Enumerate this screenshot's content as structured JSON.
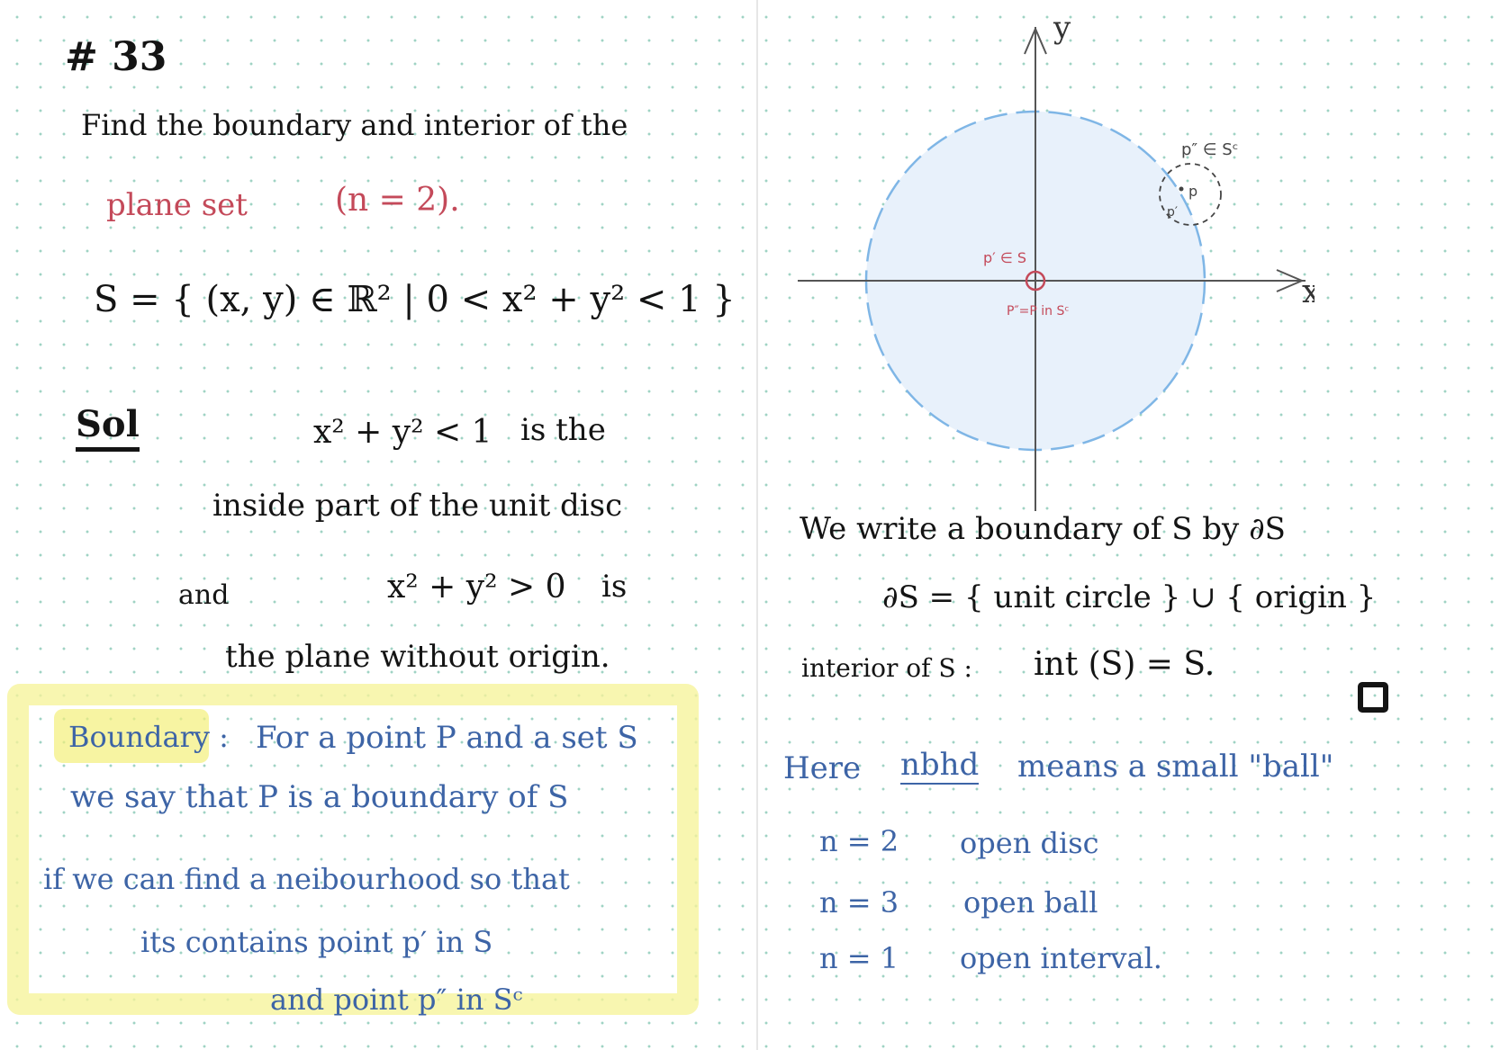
{
  "left": {
    "heading": "# 33",
    "problem_line1": "Find the boundary and interior of the",
    "problem_red1": "plane set",
    "problem_red2": "(n = 2).",
    "set_def": "S = { (x, y) ∈ ℝ² | 0 < x² + y² < 1 }",
    "sol_label": "Sol",
    "sol_expr1": "x² + y² < 1",
    "sol_is_the": "is the",
    "sol_line2": "inside part of the unit disc",
    "sol_and": "and",
    "sol_expr2": "x² + y² > 0",
    "sol_is": "is",
    "sol_line4": "the plane without origin.",
    "boundary_label": "Boundary :",
    "boundary_line1": "For a point P and a set S",
    "boundary_line2": "we say that P is a boundary of S",
    "boundary_line3": "if we can find a neibourhood so that",
    "boundary_line4": "its contains point p′ in S",
    "boundary_line5": "and point p″ in Sᶜ"
  },
  "right": {
    "axis_y": "y",
    "axis_x": "x",
    "label_p2": "p″ ∈ Sᶜ",
    "label_p": "p",
    "label_p1": "p′",
    "label_origin_top": "p′ ∈ S",
    "label_origin_bottom": "P″=P in Sᶜ",
    "line1": "We write a boundary of S by ∂S",
    "line2": "∂S = { unit circle } ∪ { origin }",
    "line3_a": "interior of S :",
    "line3_b": "int (S) = S.",
    "here": "Here",
    "nbhd": "nbhd",
    "means": "means a small \"ball\"",
    "rows": [
      {
        "n": "n = 2",
        "desc": "open disc"
      },
      {
        "n": "n = 3",
        "desc": "open ball"
      },
      {
        "n": "n = 1",
        "desc": "open interval."
      }
    ]
  },
  "colors": {
    "ink": "#141414",
    "red": "#c44a5a",
    "blue": "#3d64a6",
    "highlight": "#f6f39a",
    "disc_fill": "#e8f1fb",
    "disc_edge": "#7fb6e6"
  }
}
